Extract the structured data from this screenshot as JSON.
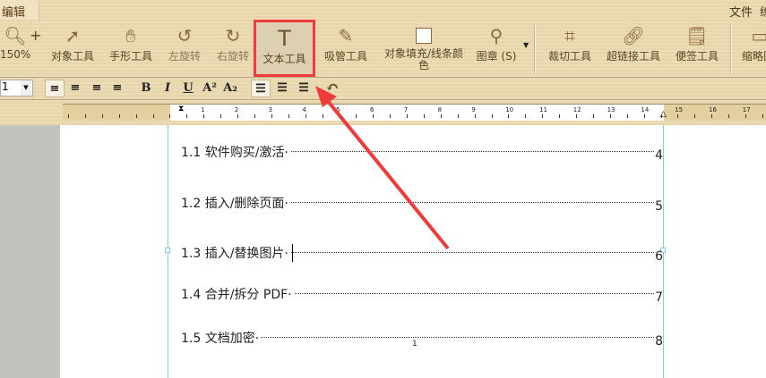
{
  "menu": {
    "tab": "编辑",
    "file": "文件",
    "cut": "练"
  },
  "tools": {
    "zoom": "150%",
    "object": "对象工具",
    "hand": "手形工具",
    "rotate_left": "左旋转",
    "rotate_right": "右旋转",
    "text": "文本工具",
    "eyedropper": "吸管工具",
    "fill": "对象填充/线条颜色",
    "stamp": "图章 (S)",
    "crop": "裁切工具",
    "link": "超链接工具",
    "note": "便签工具",
    "thumb": "缩略图"
  },
  "format": {
    "size": "1",
    "bold": "B",
    "italic": "I",
    "underline": "U",
    "sup": "A²",
    "sub": "A₂"
  },
  "ruler": [
    "1",
    "2",
    "3",
    "4",
    "5",
    "6",
    "7",
    "8",
    "9",
    "10",
    "11",
    "12",
    "13",
    "14",
    "15",
    "16",
    "17"
  ],
  "toc": [
    {
      "label": "1.1 软件购买/激活·",
      "page": "4"
    },
    {
      "label": "1.2 插入/删除页面·",
      "page": "5"
    },
    {
      "label": "1.3 插入/替换图片·",
      "page": "6"
    },
    {
      "label": "1.4 合并/拆分 PDF·",
      "page": "7"
    },
    {
      "label": "1.5 文档加密·",
      "page": "8"
    }
  ],
  "page_number": "1",
  "colors": {
    "highlight": "#ee3b3b",
    "margin": "#7ad0e6"
  }
}
